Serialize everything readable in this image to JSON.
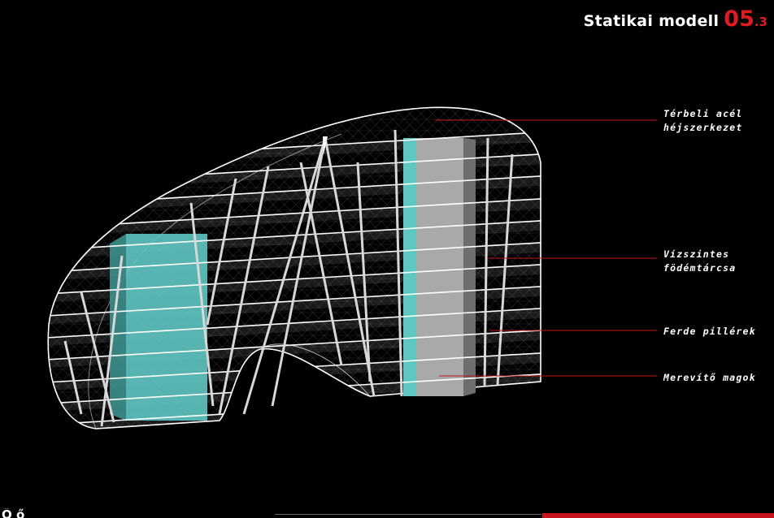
{
  "title": {
    "text": "Statikai modell",
    "number": "05",
    "sub": ".3"
  },
  "labels": {
    "acel_line1": "Térbeli acél",
    "acel_line2": "héjszerkezet",
    "fodem_line1": "Vízszintes",
    "fodem_line2": "födémtárcsa",
    "ferde": "Ferde pillérek",
    "mag": "Merevítő magok"
  },
  "footer": {
    "text": "Ő        ő"
  },
  "colors": {
    "background": "#000000",
    "accent": "#e01a22",
    "core_cyan": "#5fc6c2",
    "core_gray": "#a9a9a9",
    "wireframe": "#ffffff"
  }
}
